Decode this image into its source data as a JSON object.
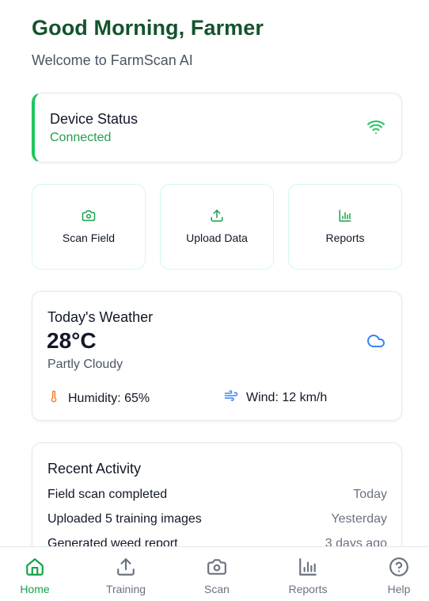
{
  "header": {
    "greeting": "Good Morning, Farmer",
    "welcome": "Welcome to FarmScan AI"
  },
  "device": {
    "title": "Device Status",
    "status": "Connected",
    "icon": "wifi-icon",
    "status_color": "#22a04b"
  },
  "actions": [
    {
      "label": "Scan Field",
      "icon": "camera-icon"
    },
    {
      "label": "Upload Data",
      "icon": "upload-icon"
    },
    {
      "label": "Reports",
      "icon": "bar-chart-icon"
    }
  ],
  "weather": {
    "title": "Today's Weather",
    "temperature": "28°C",
    "condition": "Partly Cloudy",
    "icon": "cloud-icon",
    "humidity": "Humidity: 65%",
    "wind": "Wind: 12 km/h"
  },
  "activity": {
    "title": "Recent Activity",
    "items": [
      {
        "name": "Field scan completed",
        "time": "Today"
      },
      {
        "name": "Uploaded 5 training images",
        "time": "Yesterday"
      },
      {
        "name": "Generated weed report",
        "time": "3 days ago"
      }
    ]
  },
  "nav": {
    "active": "Home",
    "items": [
      {
        "label": "Home",
        "icon": "home-icon"
      },
      {
        "label": "Training",
        "icon": "upload-icon"
      },
      {
        "label": "Scan",
        "icon": "camera-icon"
      },
      {
        "label": "Reports",
        "icon": "bar-chart-icon"
      },
      {
        "label": "Help",
        "icon": "help-icon"
      }
    ]
  },
  "colors": {
    "brand_dark": "#14532d",
    "accent": "#22c55e",
    "weather_icon": "#3b82f6",
    "humidity_icon": "#f97316"
  }
}
